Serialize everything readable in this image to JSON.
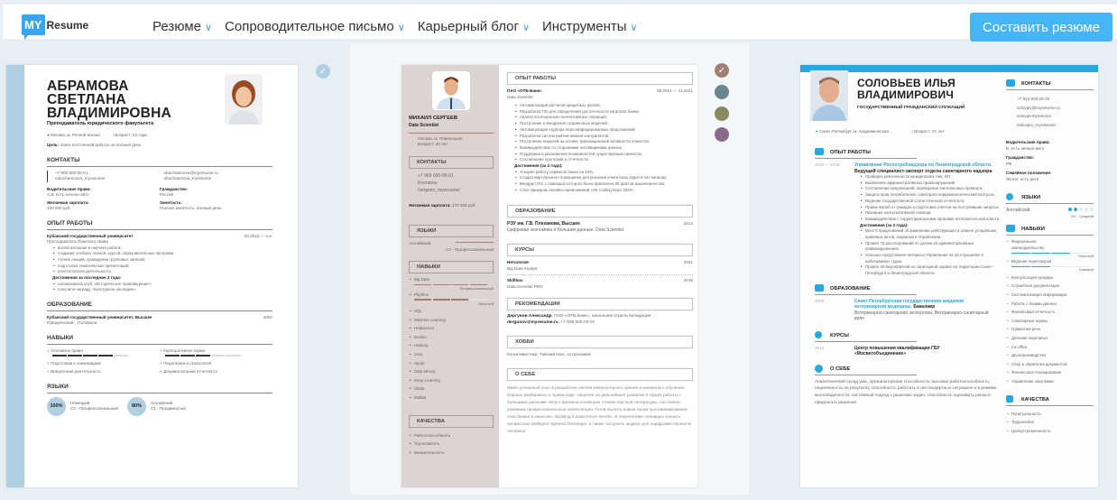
{
  "header": {
    "logo_my": "MY",
    "logo_resume": "Resume",
    "nav": [
      {
        "label": "Резюме"
      },
      {
        "label": "Сопроводительное письмо"
      },
      {
        "label": "Карьерный блог"
      },
      {
        "label": "Инструменты"
      }
    ],
    "cta": "Составить резюме"
  },
  "colors": {
    "accent": "#45b5f7",
    "template1": "#b0d0e2",
    "template2_side": "#ddd3d0",
    "template3": "#29a8e0",
    "swatches": [
      "#a07f74",
      "#6b8590",
      "#8a8a60",
      "#8a6a8a"
    ]
  },
  "r1": {
    "name": "АБРАМОВА СВЕТЛАНА ВЛАДИМИРОВНА",
    "title": "Преподаватель юридического факультета",
    "location": "Москва, м. Речной вокзал",
    "age": "Возраст: 42 года",
    "goal_label": "Цель:",
    "goal": "поиск постоянной работы на полный день",
    "contacts_h": "КОНТАКТЫ",
    "phone": "+7 900 000-00-01",
    "fb": "/obuchaemova_myresume/",
    "email": "obuchaemova@myresume.ru",
    "skype": "obuchaemova_myresume",
    "f1l": "Водительские права:",
    "f1v": "А,В, есть личное авто",
    "f2l": "Гражданство:",
    "f2v": "Россия",
    "f3l": "Желаемая зарплата:",
    "f3v": "120 000 руб",
    "f4l": "Занятость:",
    "f4v": "Полная занятость, полный день",
    "exp_h": "ОПЫТ РАБОТЫ",
    "exp_org": "Кубанский государственный университет",
    "exp_date": "03.2012 — н.в.",
    "exp_pos": "Преподаватель Римского права",
    "exp_items": [
      "воспитательная и научная работа;",
      "создание учебных планов, курсов, образовательных программ;",
      "чтение лекций, проведение групповых занятий;",
      "подготовка тематических презентаций;",
      "репетиторская деятельность."
    ],
    "ach_h": "Достижения за последние 3 года:",
    "ach_items": [
      "организовала клуб «Историческое правоведение»;",
      "получила награду «Культурное наследие»."
    ],
    "edu_h": "ОБРАЗОВАНИЕ",
    "edu_org": "Кубанский государственный университет, Высшее",
    "edu_year": "2004",
    "edu_spec": "Юридический , Уголовное",
    "skills_h": "НАВЫКИ",
    "skills": [
      {
        "name": "Уголовное право",
        "level": 4
      },
      {
        "name": "Корпоративное право",
        "level": 3
      },
      {
        "name": "Подготовка к олимпиадам"
      },
      {
        "name": "Педагогика и психология"
      },
      {
        "name": "Внеурочная деятельность"
      },
      {
        "name": "Документальная отчетность"
      }
    ],
    "lang_h": "ЯЗЫКИ",
    "langs": [
      {
        "pct": "100%",
        "name": "Немецкий",
        "level": "C2 - Профессиональный"
      },
      {
        "pct": "80%",
        "name": "Английский",
        "level": "C1 - Продвинутый"
      }
    ]
  },
  "r2": {
    "name": "МИХАИЛ СЕРГЕЕВ",
    "title": "Data Scientist",
    "location": "Москва, м. Павелецкая",
    "age": "Возраст: 30 лет",
    "contacts_h": "КОНТАКТЫ",
    "phone": "+7 969 000-00-01",
    "contacts": "Контакты",
    "fb": "/sergeev_myresume/",
    "salary_l": "Желаемая зарплата:",
    "salary": "170 000 руб",
    "lang_h": "ЯЗЫКИ",
    "lang": "Английский",
    "lang_level": "C2 - Профессиональный",
    "skills_h": "НАВЫКИ",
    "skill1": "Big Data",
    "skill1_level": "Профессиональный",
    "skill2": "Phython",
    "skill2_level": "Опытный",
    "skills": [
      "SQL",
      "Machine Learning",
      "Нейросети",
      "Docker",
      "Hadoop",
      "Java",
      "Spark",
      "Data Mining",
      "Deep Learning",
      "Skala",
      "Matlab"
    ],
    "qual_h": "КАЧЕСТВА",
    "quals": [
      "Работоспособность",
      "Терпеливость",
      "Внимательность"
    ],
    "exp_h": "ОПЫТ РАБОТЫ",
    "exp_org": "ПАО «ОТБ-Банк»",
    "exp_date": "08.2014 — 11.2021",
    "exp_pos": "Data Scientist",
    "exp_items": [
      "Автоматизация расчетов кредитных рисков;",
      "Разработка ПО для определения достаточности капитала банка;",
      "Анализ потенциально нелегитимных операций;",
      "Построение и внедрение скоринговых моделей;",
      "Автоматизация подбора персонифицированных предложений;",
      "Разработка систем рейтингования контрагентов;",
      "Построение моделей на основе транзакционной активности клиентов;",
      "Взаимодействие со сторонними поставщиками данных;",
      "Поддержка и расширение возможностей существующих проектов;",
      "Составление прогнозов и отчетности."
    ],
    "ach_h": "Достижения (за 2 года):",
    "ach_items": [
      "Ускорил работу сервисов банка на 40%;",
      "Создал виртуального помощника для решения клиентских задач в чат-каналах;",
      "Внедрил ПО, с помощью которого было присвоено 25 фактов мошенничества;",
      "Стал призером онлайн-соревнований «SK Coding Days 2020»."
    ],
    "edu_h": "ОБРАЗОВАНИЕ",
    "edu_org": "РЭУ им. Г.В. Плеханова, Высшее",
    "edu_year": "2014",
    "edu_spec": "Цифровая экономика и большие данные, Data Scientist",
    "courses_h": "КУРСЫ",
    "c1": "Нетология",
    "c1y": "2021",
    "c1d": "Big Data Analyst",
    "c2": "Skillbox",
    "c2y": "2016",
    "c2d": "Data Scientist PRO",
    "rec_h": "РЕКОМЕНДАЦИИ",
    "rec_name": "Дергунов Александр",
    "rec_text": ", ПАО «ОТБ-Банк», начальник отдела валидации",
    "rec_email": "dergunov@myresume.ru",
    "rec_phone": ", +7 929 000-00-01",
    "hobby_h": "ХОББИ",
    "hobby": "Когнитивистика, Тайский бокс, Астрономия.",
    "about_h": "О СЕБЕ",
    "about": "Имею успешный опыт в разработке систем компьютерного зрения и машинного обучения. Хорошо разбираюсь в чужом коде. Нацелен на дальнейшее развитие в сфере работы с большими данными. Много времени посвящаю чтению научной литературы, постоянно развиваю профессиональные компетенции. Готов изучить новые языки программирования. Участвовал в хакатоне «Building a Data-Driven World». В перспективе планирую освоить профессию Intelligent Systems Developer, а также построить модель для оцифровки личности человека."
  },
  "r3": {
    "name": "СОЛОВЬЕВ ИЛЬЯ ВЛАДИМИРОВИЧ",
    "title": "ГОСУДАРСТВЕННЫЙ ГРАЖДАНСКИЙ СЛУЖАЩИЙ",
    "location": "Санкт-Петербург, м. Академическая",
    "age": "Возраст: 37 лет",
    "exp_h": "ОПЫТ РАБОТЫ",
    "exp_date": "2010 — 2018",
    "exp_org": "Управление Роспотребнадзора по Ленинградской области.",
    "exp_pos": " Ведущий специалист-эксперт отдела санитарного надзора",
    "exp_items": [
      "Проверка деятельности юридических лиц, ИП",
      "Выявление административных правонарушений",
      "Составление предписаний, проведение внеплановых проверок",
      "Защита прав потребителей, санитарно-эпидемиологический контроль",
      "Ведение государственной статистической отчетности",
      "Прием жалоб от граждан и подготовка ответов на поступившие запросы",
      "Оказание консультативной помощи",
      "Взаимодействие с территориальными органами исполнительной власти"
    ],
    "ach_h": "Достижения (за 2 года):",
    "ach_items": [
      "Внес 5 предложений об изменении действующих и отмене устаревших правовых актов, изданных в Управлении.",
      "Провел 75 расследований по делам об административных правонарушениях.",
      "Успешно представлял интересы Управления на 15 слушаниях в арбитражных судах.",
      "Провел 40 мероприятий по санитарной охране на территории Санкт-Петербурга и Ленинградской области"
    ],
    "edu_h": "ОБРАЗОВАНИЕ",
    "edu_year": "2009",
    "edu_org": "Санкт-Петербургская государственная академия ветеринарной медицины.",
    "edu_deg": " Бакалавр",
    "edu_spec": "Ветеринарно-санитарная экспертиза, Ветеринарно-санитарный врач",
    "courses_h": "КУРСЫ",
    "course_year": "2012",
    "course": "Центр повышения квалификации ГБУ «Мосветобъединение»",
    "about_h": "О СЕБЕ",
    "about": "Аналитический склад ума, организаторские способности, высокая работоспособность, нацеленность на результат, способность работать в нестандартных ситуациях и в режиме многозадачности, системный подход к решению задач, способность оценивать риски и предлагать решения",
    "contacts_h": "КОНТАКТЫ",
    "phone": "+7 812 926-25-25",
    "email": "solovjev@myresume.ru",
    "skype": "solovjevmyresume",
    "vk": "/solovjev_myresume/",
    "f1l": "Водительские права:",
    "f1v": "B, есть личное авто",
    "f2l": "Гражданство:",
    "f2v": "РФ",
    "f3l": "Семейное положение:",
    "f3v": "Женат, есть дети",
    "lang_h": "ЯЗЫКИ",
    "lang": "Английский",
    "lang_level": "B1 - Средний",
    "skills_h": "НАВЫКИ",
    "skill1": "Федеральное законодательство",
    "skill1_level": "Опытный",
    "skill2": "Ведение переговоров",
    "skill2_level": "Базовый",
    "skills": [
      "Консультация граждан",
      "Служебная документация",
      "Систематизация информации",
      "Работа с базами данных",
      "Финансовая отчетность",
      "Санитарные нормы",
      "Грамотная речь",
      "Деловая переписка",
      "ms office",
      "Делопроизводство",
      "Сбор и обработка документов",
      "Финансовое планирование",
      "Управление закупками"
    ],
    "qual_h": "КАЧЕСТВА",
    "quals": [
      "Пунктуальность",
      "Трудолюбие",
      "Целеустремленность"
    ]
  }
}
